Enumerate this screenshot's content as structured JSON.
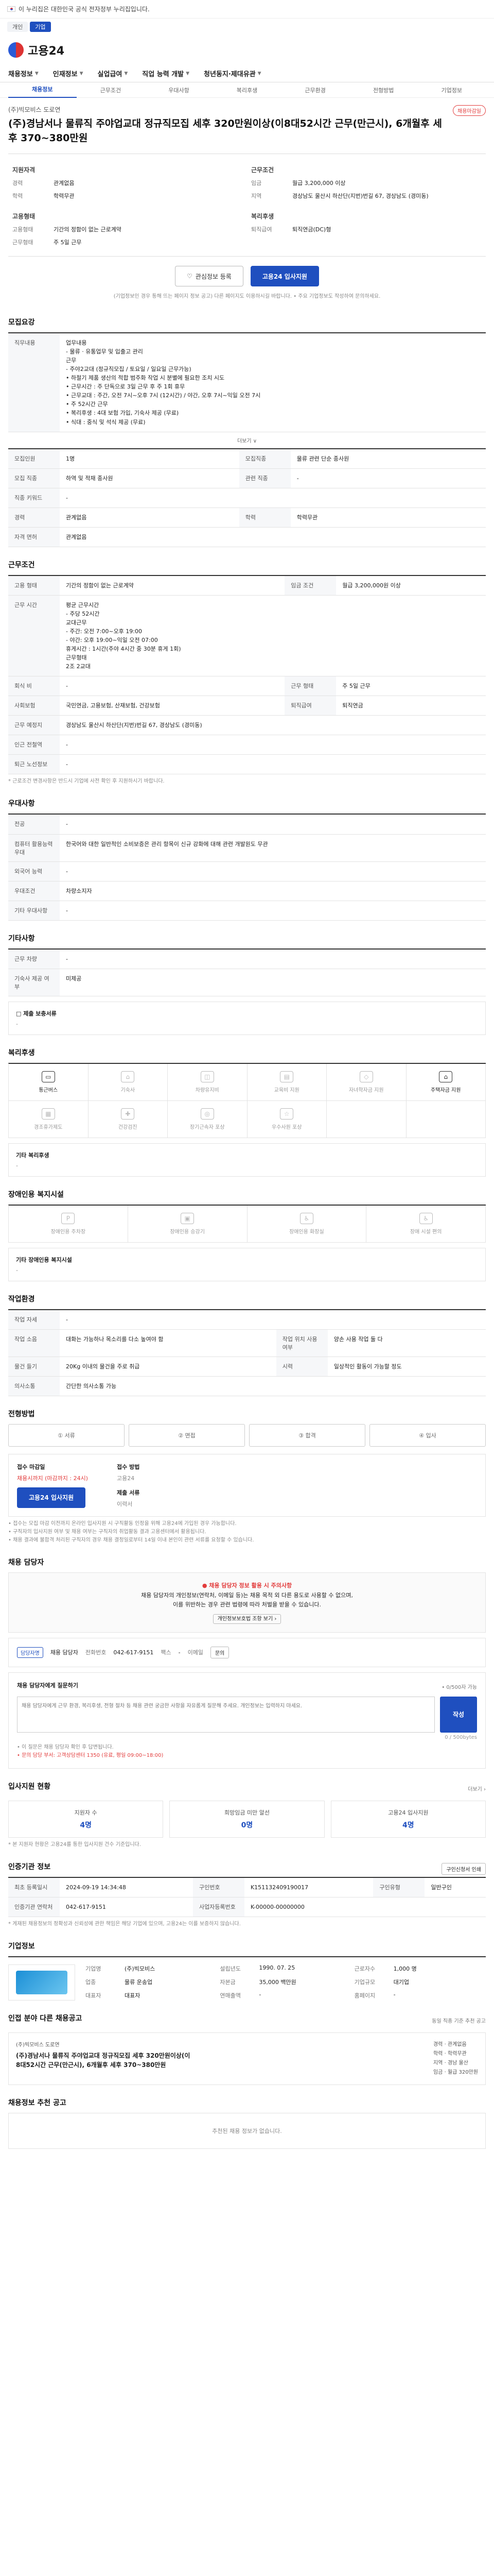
{
  "gov": {
    "notice": "이 누리집은 대한민국 공식 전자정부 누리집입니다.",
    "chips": [
      "개인",
      "기업"
    ]
  },
  "brand": {
    "name": "고용24"
  },
  "gnb": [
    "채용정보",
    "인재정보",
    "실업급여",
    "직업 능력 개발",
    "청년동지·제대유관"
  ],
  "subtabs": [
    "채용정보",
    "근무조건",
    "우대사항",
    "복리후생",
    "근무환경",
    "전형방법",
    "기업정보"
  ],
  "title": {
    "company": "(주)빅모비스 도로연",
    "text": "(주)경남서나 물류직 주야업교대 정규직모집 세후 320만원이상(이8대52시간 근무(만근시), 6개월후 세후 370~380만원",
    "badge": "채용마감일"
  },
  "summary": {
    "left_title": "지원자격",
    "left": [
      {
        "k": "경력",
        "v": "관계없음"
      },
      {
        "k": "학력",
        "v": "학력무관"
      }
    ],
    "left2_title": "고용형태",
    "left2": [
      {
        "k": "고용형태",
        "v": "기간의 정함이 없는 근로계약"
      },
      {
        "k": "근무형태",
        "v": "주 5일 근무"
      }
    ],
    "right_title": "근무조건",
    "right": [
      {
        "k": "임금",
        "v": "월급 3,200,000 이상"
      },
      {
        "k": "지역",
        "v": "경상남도 울산시 하산단(지번)번길 67, 경상남도 (경미동)"
      }
    ],
    "right2_title": "복리후생",
    "right2": [
      {
        "k": "퇴직급여",
        "v": "퇴직연금(DC)형"
      }
    ]
  },
  "cta": {
    "save": "관심정보 등록",
    "apply": "고용24 입사지원"
  },
  "cta_notice": "(기업정보인 경우 통해 뜨는 페이지 정보 공고) 다른 페이지도 이용하시길 바랍니다. • 주요 기업정보도 작성하여 문의하세요.",
  "recruit": {
    "title": "모집요강",
    "duty_label": "직무내용",
    "duty": "업무내용\n- 물류 · 유통업무 및 입출고 관리\n근무\n- 주야2교대 (정규직모집 / 토요일 / 일요일 근무가능)\n• 하절기 제품 생산의 적합 범주화 작업 시 분별에 필요한 조치 시도\n• 근무시간 : 주 단독으로 3일 근무 후 주 1회 휴무\n• 근무교대 : 주간, 오전 7시~오후 7시 (12시간) / 야간, 오후 7시~익일 오전 7시\n• 주 52시간 근무\n• 복리후생 : 4대 보험 가입, 기숙사 제공 (무료)\n• 식대 : 중식 및 석식 제공 (무료)",
    "more": "더보기 ∨",
    "rows": [
      {
        "k1": "모집인원",
        "v1": "1명",
        "k2": "모집직종",
        "v2": "물류 관련 단순 종사원"
      },
      {
        "k1": "모집 직종",
        "v1": "하역 및 적재 종사원",
        "k2": "관련 직종",
        "v2": "-"
      },
      {
        "k1": "직종 키워드",
        "v1": "-",
        "k2": "",
        "v2": ""
      },
      {
        "k1": "경력",
        "v1": "관계없음",
        "k2": "학력",
        "v2": "학력무관"
      },
      {
        "k1": "자격 면허",
        "v1": "관계없음",
        "k2": "",
        "v2": ""
      }
    ]
  },
  "work": {
    "title": "근무조건",
    "rows": [
      {
        "k1": "고용 형태",
        "v1": "기간의 정함이 없는 근로계약",
        "k2": "임금 조건",
        "v2": "월급 3,200,000원 이상"
      },
      {
        "k1": "근무 시간",
        "v1": "평균 근무시간\n- 주당 52시간\n교대근무\n- 주간: 오전 7:00~오후 19:00\n- 야간: 오후 19:00~익일 오전 07:00\n휴게시간 : 1시간(주야 4시간 중 30분 휴게 1회)\n근무형태\n2조 2교대",
        "k2": "",
        "v2": ""
      },
      {
        "k1": "회식 비",
        "v1": "-",
        "k2": "근무 형태",
        "v2": "주 5일 근무"
      },
      {
        "k1": "사회보험",
        "v1": "국민연금, 고용보험, 산재보험, 건강보험",
        "k2": "퇴직급여",
        "v2": "퇴직연금"
      },
      {
        "k1": "근무 예정지",
        "v1": "경상남도 울산시 하산단(지번)번길 67, 경상남도 (경미동)",
        "k2": "",
        "v2": ""
      },
      {
        "k1": "인근 전철역",
        "v1": "-",
        "k2": "",
        "v2": ""
      },
      {
        "k1": "퇴근 노선정보",
        "v1": "-",
        "k2": "",
        "v2": ""
      }
    ],
    "note": "* 근로조건 변경사항은 반드시 기업에 사전 확인 후 지원하시기 바랍니다."
  },
  "pref": {
    "title": "우대사항",
    "rows": [
      {
        "k1": "전공",
        "v1": "-"
      },
      {
        "k1": "컴퓨터 활용능력 우대",
        "v1": "한국어와 대한 일반적인 소비보증은 관리 항목이 신규 강화에 대해 관련 개발원도 무관"
      },
      {
        "k1": "외국어 능력",
        "v1": "-"
      },
      {
        "k1": "우대조건",
        "v1": "차량소지자"
      },
      {
        "k1": "기타 우대사항",
        "v1": "-"
      }
    ]
  },
  "etc": {
    "title": "기타사항",
    "rows": [
      {
        "k1": "근무 차량",
        "v1": "-"
      },
      {
        "k1": "기숙사 제공 여부",
        "v1": "미제공"
      }
    ],
    "box_title": "□ 제출 보충서류",
    "box_val": "-"
  },
  "welfare": {
    "title": "복리후생",
    "cells": [
      {
        "label": "통근버스",
        "on": true
      },
      {
        "label": "기숙사",
        "on": false
      },
      {
        "label": "차량유지비",
        "on": false
      },
      {
        "label": "교육비 지원",
        "on": false
      },
      {
        "label": "자녀학자금 지원",
        "on": false
      },
      {
        "label": "주택자금 지원",
        "on": true
      },
      {
        "label": "경조휴가제도",
        "on": false
      },
      {
        "label": "건강검진",
        "on": false
      },
      {
        "label": "장기근속자 포상",
        "on": false
      },
      {
        "label": "우수사원 포상",
        "on": false
      },
      {
        "label": "",
        "on": false
      },
      {
        "label": "",
        "on": false
      }
    ],
    "box_title": "기타 복리후생",
    "box_val": "-"
  },
  "disab": {
    "title": "장애인용 복지시설",
    "cells": [
      "장애인용 주차장",
      "장애인용 승강기",
      "장애인용 화장실",
      "장애 시설 편의"
    ],
    "box_title": "기타 장애인용 복지시설",
    "box_val": "-"
  },
  "env": {
    "title": "작업환경",
    "rows": [
      {
        "k1": "작업 자세",
        "v1": "-",
        "k2": "",
        "v2": ""
      },
      {
        "k1": "작업 소음",
        "v1": "대화는 가능하나 목소리를 다소 높여야 함",
        "k2": "작업 위치 사용 여부",
        "v2": "양손 사용 작업 둘 다"
      },
      {
        "k1": "물건 들기",
        "v1": "20Kg 이내의 물건을 주로 취급",
        "k2": "시력",
        "v2": "일상적인 활동이 가능할 정도"
      },
      {
        "k1": "의사소통",
        "v1": "간단한 의사소통 가능",
        "k2": "",
        "v2": ""
      }
    ]
  },
  "proc": {
    "title": "전형방법",
    "steps": [
      "① 서류",
      "② 면접",
      "③ 합격",
      "④ 입사"
    ],
    "apply_label": "접수 마감일",
    "apply_val": "채용시까지 (마감까지 : 24시)",
    "apply_btn": "고용24 입사지원",
    "method_label": "접수 방법",
    "method_val": "고용24",
    "doc_label": "제출 서류",
    "doc_val": "이력서",
    "notes": [
      "• 접수는 모집 마감 이전까지 온라인 입사지원 시 구직활동 인정을 위해 고용24에 가입된 경우 가능합니다.",
      "• 구직자의 입사지원 여부 및 채용 여부는 구직자의 취업활동 결과 고용센터에서 활용됩니다.",
      "• 채용 결과에 불합격 처리된 구직자의 경우 채용 결정일로부터 14일 이내 본인이 관련 서류를 요청할 수 있습니다."
    ]
  },
  "contact": {
    "title": "채용 담당자",
    "warn": "● 채용 담당자 정보 활용 시 주의사항",
    "lines": [
      "채용 담당자의 개인정보(연락처, 이메일 등)는 채용 목적 외 다른 용도로 사용할 수 없으며,",
      "이를 위반하는 경우 관련 법령에 따라 처벌을 받을 수 있습니다."
    ],
    "link": "개인정보보호법 조항 보기 ›",
    "tag": "담당자명",
    "name": "채용 담당자",
    "tel_label": "전화번호",
    "tel": "042-617-9151",
    "fax_label": "팩스",
    "fax": "-",
    "email_label": "이메일",
    "email_btn": "문의"
  },
  "ask": {
    "title": "채용 담당자에게 질문하기",
    "hint": "• 0/500자 가능",
    "placeholder": "채용 담당자에게 근무 환경, 복리후생, 전형 절차 등 채용 관련 궁금한 사항을 자유롭게 질문해 주세요. 개인정보는 입력하지 마세요.",
    "send": "작성",
    "count": "0 / 500bytes",
    "note1": "• 이 질문은 채용 담당자 확인 후 답변됩니다.",
    "note2": "• 문의 담당 부서: 고객상담센터 1350 (유료, 평일 09:00~18:00)"
  },
  "stats": {
    "title": "입사지원 현황",
    "more": "더보기 ›",
    "items": [
      {
        "t": "지원자 수",
        "n": "4명"
      },
      {
        "t": "희망임금 미만 알선",
        "n": "0명"
      },
      {
        "t": "고용24 입사지원",
        "n": "4명"
      }
    ],
    "note": "* 본 지원자 현황은 고용24를 통한 입사지원 건수 기준입니다."
  },
  "agency": {
    "title": "인증기관 정보",
    "btn": "구인신청서 인쇄",
    "rows": [
      {
        "k1": "최초 등록일시",
        "v1": "2024-09-19 14:34:48",
        "k2": "구인번호",
        "v2": "K151132409190017",
        "k3": "구인유형",
        "v3": "일반구인"
      },
      {
        "k1": "인증기관 연락처",
        "v1": "042-617-9151",
        "k2": "사업자등록번호",
        "v2": "K-00000-00000000",
        "k3": "",
        "v3": ""
      }
    ],
    "note": "* 게재된 채용정보의 정확성과 신뢰성에 관한 책임은 해당 기업에 있으며, 고용24는 이를 보증하지 않습니다."
  },
  "company": {
    "title": "기업정보",
    "kv": [
      {
        "k": "기업명",
        "v": "(주)빅모비스"
      },
      {
        "k": "업종",
        "v": "물류 운송업"
      },
      {
        "k": "대표자",
        "v": "대표자"
      },
      {
        "k": "설립년도",
        "v": "1990. 07. 25"
      },
      {
        "k": "자본금",
        "v": "35,000 백만원"
      },
      {
        "k": "연매출액",
        "v": "-"
      },
      {
        "k": "근로자수",
        "v": "1,000 명"
      },
      {
        "k": "기업규모",
        "v": "대기업"
      },
      {
        "k": "홈페이지",
        "v": "-"
      }
    ]
  },
  "similar": {
    "title": "인접 분야 다른 채용공고",
    "aside": "동일 직종 기준 추천 공고",
    "company": "(주)빅모비스 도로연",
    "text": "(주)경남서나 물류직 주야업교대 정규직모집 세후 320만원이상(이8대52시간 근무(만근시), 6개월후 세후 370~380만원",
    "kv": [
      "경력 · 관계없음",
      "학력 · 학력무관",
      "지역 · 경남 울산",
      "임금 · 월급 320만원"
    ]
  },
  "bottom": {
    "title": "채용정보 추천 공고",
    "empty": "추천된 채용 정보가 없습니다."
  }
}
